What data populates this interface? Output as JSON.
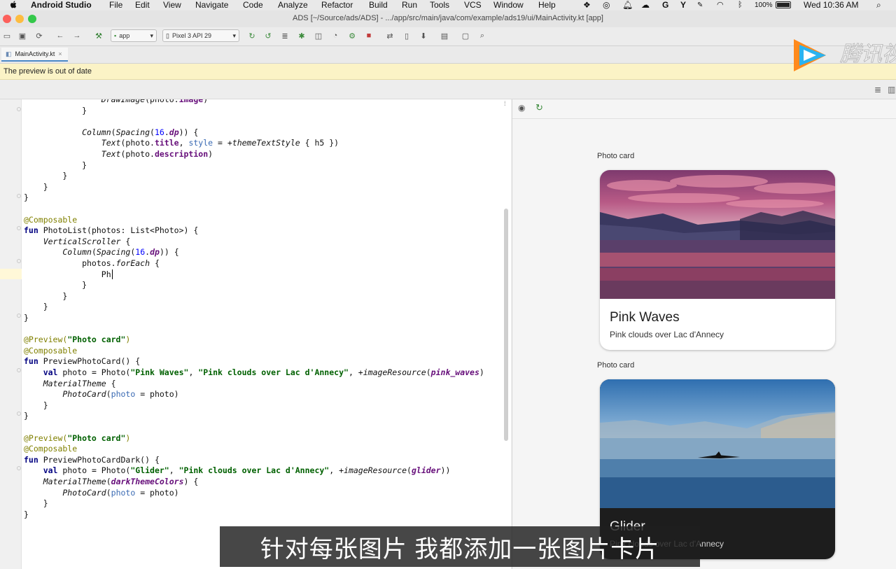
{
  "menubar": {
    "app_name": "Android Studio",
    "items": [
      "File",
      "Edit",
      "View",
      "Navigate",
      "Code",
      "Analyze",
      "Refactor",
      "Build",
      "Run",
      "Tools",
      "VCS",
      "Window",
      "Help"
    ],
    "battery": "100%",
    "clock": "Wed 10:36 AM"
  },
  "window": {
    "title": "ADS [~/Source/ads/ADS] - .../app/src/main/java/com/example/ads19/ui/MainActivity.kt [app]"
  },
  "toolbar": {
    "module_combo": "app",
    "device_combo": "Pixel 3 API 29"
  },
  "tabs": [
    {
      "label": "MainActivity.kt"
    }
  ],
  "warning": {
    "text": "The preview is out of date"
  },
  "code_lines": [
    "                DrawImage(photo.image)",
    "            }",
    "",
    "            Column(Spacing(16.dp)) {",
    "                Text(photo.title, style = +themeTextStyle { h5 })",
    "                Text(photo.description)",
    "            }",
    "        }",
    "    }",
    "}",
    "",
    "@Composable",
    "fun PhotoList(photos: List<Photo>) {",
    "    VerticalScroller {",
    "        Column(Spacing(16.dp)) {",
    "            photos.forEach {",
    "                Ph",
    "            }",
    "        }",
    "    }",
    "}",
    "",
    "@Preview(\"Photo card\")",
    "@Composable",
    "fun PreviewPhotoCard() {",
    "    val photo = Photo(\"Pink Waves\", \"Pink clouds over Lac d'Annecy\", +imageResource(pink_waves)",
    "    MaterialTheme {",
    "        PhotoCard(photo = photo)",
    "    }",
    "}",
    "",
    "@Preview(\"Photo card\")",
    "@Composable",
    "fun PreviewPhotoCardDark() {",
    "    val photo = Photo(\"Glider\", \"Pink clouds over Lac d'Annecy\", +imageResource(glider))",
    "    MaterialTheme(darkThemeColors) {",
    "        PhotoCard(photo = photo)",
    "    }",
    "}"
  ],
  "preview": {
    "cards": [
      {
        "label": "Photo card",
        "title": "Pink Waves",
        "description": "Pink clouds over Lac d'Annecy",
        "theme": "light"
      },
      {
        "label": "Photo card",
        "title": "Glider",
        "description": "Pink clouds over Lac d'Annecy",
        "theme": "dark"
      }
    ]
  },
  "subtitle": "针对每张图片 我都添加一张图片卡片",
  "watermark": {
    "brand": "腾讯视频"
  },
  "colors": {
    "warning_bg": "#fbf3c6",
    "tab_accent": "#4a88c7",
    "dark_card_bg": "#1d1d1d",
    "subtitle_bg": "#1e1e1e"
  }
}
